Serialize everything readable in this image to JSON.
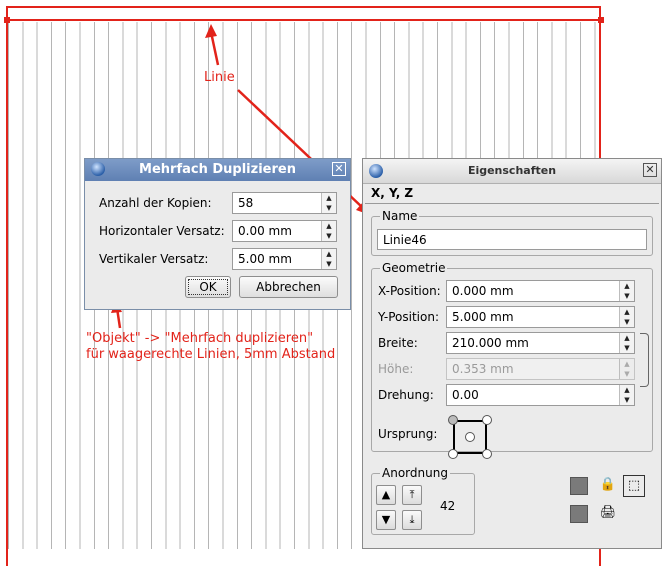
{
  "annotations": {
    "line_label": "Linie",
    "note_line1": "\"Objekt\" -> \"Mehrfach duplizieren\"",
    "note_line2": "für waagerechte Linien, 5mm Abstand"
  },
  "dialog": {
    "title": "Mehrfach Duplizieren",
    "fields": [
      {
        "label": "Anzahl der Kopien:",
        "value": "58"
      },
      {
        "label": "Horizontaler Versatz:",
        "value": "0.00 mm"
      },
      {
        "label": "Vertikaler Versatz:",
        "value": "5.00 mm"
      }
    ],
    "ok_label": "OK",
    "cancel_label": "Abbrechen"
  },
  "properties": {
    "title": "Eigenschaften",
    "tab_label": "X, Y, Z",
    "name_group": "Name",
    "name_value": "Linie46",
    "geometry_group": "Geometrie",
    "geometry": [
      {
        "label": "X-Position:",
        "value": "0.000 mm"
      },
      {
        "label": "Y-Position:",
        "value": "5.000 mm"
      },
      {
        "label": "Breite:",
        "value": "210.000 mm"
      },
      {
        "label": "Höhe:",
        "value": "0.353 mm",
        "disabled": true
      },
      {
        "label": "Drehung:",
        "value": "0.00"
      }
    ],
    "origin_label": "Ursprung:",
    "arrangement_group": "Anordnung",
    "level_value": "42"
  },
  "colors": {
    "accent": "#e2231a",
    "titlebar": "#6b8bbf"
  }
}
